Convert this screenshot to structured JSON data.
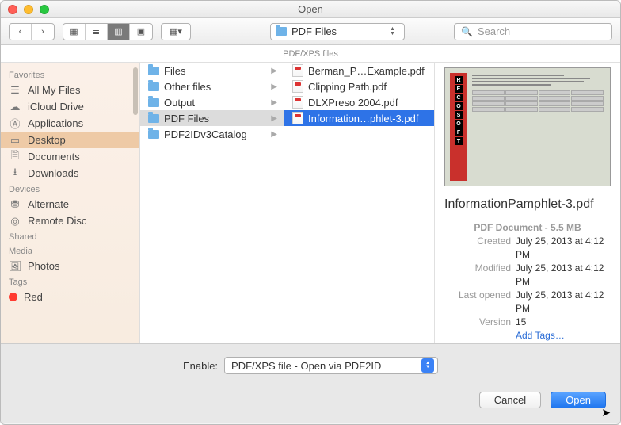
{
  "window": {
    "title": "Open"
  },
  "toolbar": {
    "path_label": "PDF Files",
    "search_placeholder": "Search"
  },
  "subtitle": "PDF/XPS files",
  "sidebar": {
    "sections": {
      "favorites": "Favorites",
      "devices": "Devices",
      "shared": "Shared",
      "media": "Media",
      "tags": "Tags"
    },
    "favorites": [
      {
        "icon": "all-files",
        "label": "All My Files"
      },
      {
        "icon": "cloud",
        "label": "iCloud Drive"
      },
      {
        "icon": "apps",
        "label": "Applications"
      },
      {
        "icon": "desktop",
        "label": "Desktop"
      },
      {
        "icon": "documents",
        "label": "Documents"
      },
      {
        "icon": "downloads",
        "label": "Downloads"
      }
    ],
    "devices": [
      {
        "icon": "disk",
        "label": "Alternate"
      },
      {
        "icon": "remote",
        "label": "Remote Disc"
      }
    ],
    "media": [
      {
        "icon": "photos",
        "label": "Photos"
      }
    ],
    "tags": [
      {
        "color": "#ff3b30",
        "label": "Red"
      }
    ]
  },
  "column1": [
    {
      "label": "Files"
    },
    {
      "label": "Other files"
    },
    {
      "label": "Output"
    },
    {
      "label": "PDF Files",
      "selected": true
    },
    {
      "label": "PDF2IDv3Catalog"
    }
  ],
  "column2": [
    {
      "label": "Berman_P…Example.pdf"
    },
    {
      "label": "Clipping Path.pdf"
    },
    {
      "label": "DLXPreso 2004.pdf"
    },
    {
      "label": "Information…phlet-3.pdf",
      "selected": true
    }
  ],
  "preview": {
    "strip_letters": [
      "R",
      "E",
      "C",
      "O",
      "S",
      "O",
      "F",
      "T"
    ],
    "filename": "InformationPamphlet-3.pdf",
    "doc_summary": "PDF Document - 5.5 MB",
    "rows": [
      {
        "label": "Created",
        "value": "July 25, 2013 at 4:12 PM"
      },
      {
        "label": "Modified",
        "value": "July 25, 2013 at 4:12 PM"
      },
      {
        "label": "Last opened",
        "value": "July 25, 2013 at 4:12 PM"
      },
      {
        "label": "Version",
        "value": "15"
      }
    ],
    "add_tags": "Add Tags…"
  },
  "bottom": {
    "enable_label": "Enable:",
    "enable_value": "PDF/XPS file - Open via PDF2ID",
    "cancel": "Cancel",
    "open": "Open"
  }
}
